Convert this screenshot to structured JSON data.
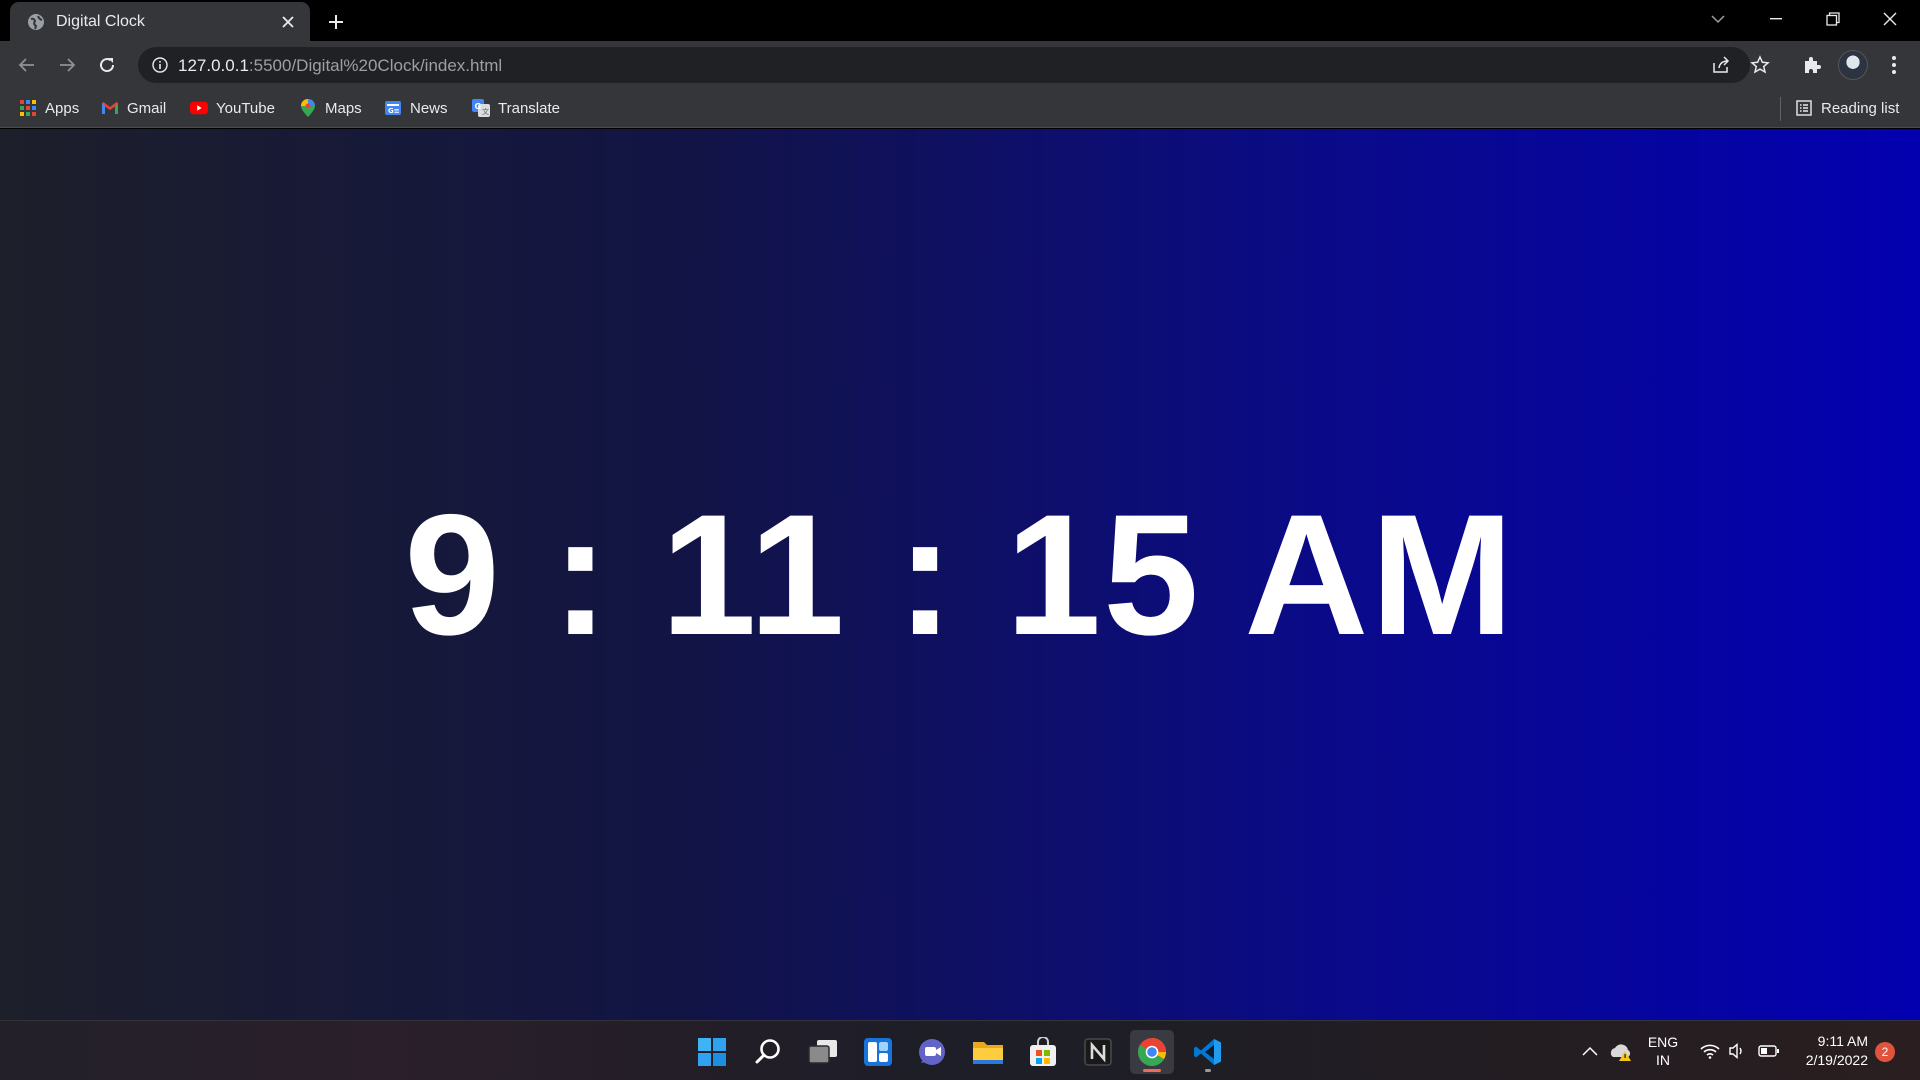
{
  "browser": {
    "tab": {
      "title": "Digital Clock",
      "favicon": "globe-icon"
    },
    "address": {
      "host": "127.0.0.1",
      "rest": ":5500/Digital%20Clock/index.html"
    },
    "bookmarks": [
      {
        "label": "Apps",
        "icon": "apps-grid-icon"
      },
      {
        "label": "Gmail",
        "icon": "gmail-icon"
      },
      {
        "label": "YouTube",
        "icon": "youtube-icon"
      },
      {
        "label": "Maps",
        "icon": "maps-icon"
      },
      {
        "label": "News",
        "icon": "news-icon"
      },
      {
        "label": "Translate",
        "icon": "translate-icon"
      }
    ],
    "reading_list": "Reading list"
  },
  "page": {
    "clock": {
      "hours": "9",
      "minutes": "11",
      "seconds": "15",
      "period": "AM",
      "separator": ":"
    },
    "colors": {
      "gradient_start": "#1d1f2a",
      "gradient_end": "#0300b0",
      "text": "#ffffff"
    }
  },
  "taskbar": {
    "apps": [
      "start-icon",
      "search-icon",
      "task-view-icon",
      "widgets-icon",
      "teams-chat-icon",
      "file-explorer-icon",
      "microsoft-store-icon",
      "notion-icon",
      "chrome-icon",
      "vscode-icon"
    ],
    "tray": {
      "lang_line1": "ENG",
      "lang_line2": "IN",
      "time": "9:11 AM",
      "date": "2/19/2022",
      "notifications": "2"
    }
  }
}
